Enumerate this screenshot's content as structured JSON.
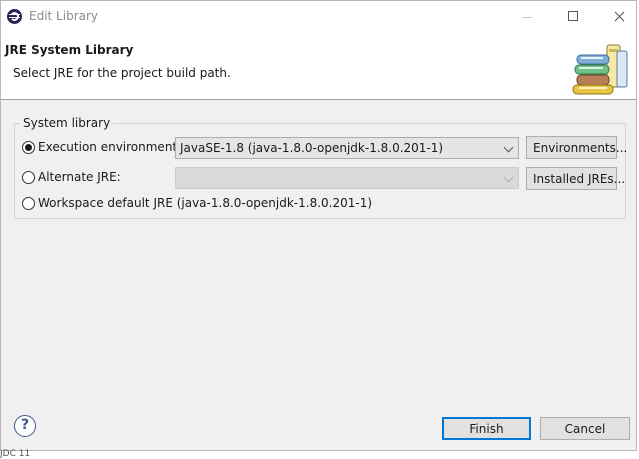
{
  "window": {
    "title": "Edit Library"
  },
  "banner": {
    "title": "JRE System Library",
    "description": "Select JRE for the project build path.",
    "image_icon": "books-icon"
  },
  "group": {
    "label": "System library",
    "options": [
      {
        "label": "Execution environment:",
        "selected": true,
        "combo_value": "JavaSE-1.8 (java-1.8.0-openjdk-1.8.0.201-1)",
        "button_label": "Environments..."
      },
      {
        "label": "Alternate JRE:",
        "selected": false,
        "combo_value": "",
        "button_label": "Installed JREs..."
      },
      {
        "label": "Workspace default JRE (java-1.8.0-openjdk-1.8.0.201-1)",
        "selected": false
      }
    ]
  },
  "footer": {
    "help_glyph": "?",
    "finish_label": "Finish",
    "cancel_label": "Cancel",
    "cut_text": "JDC   11"
  },
  "colors": {
    "accent": "#0078d7",
    "dialog_bg": "#f0f0f0"
  }
}
